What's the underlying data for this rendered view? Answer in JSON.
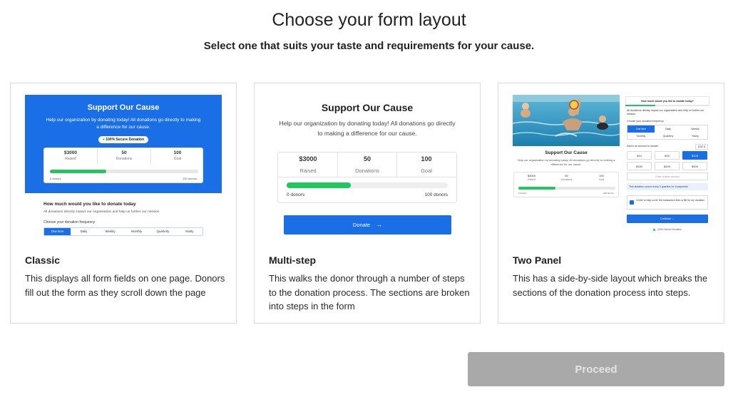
{
  "header": {
    "title": "Choose your form layout",
    "subtitle": "Select one that suits your taste and requirements for your cause."
  },
  "colors": {
    "accent": "#1a6ee6",
    "progress": "#22c55e",
    "button_disabled": "#a9a9a9"
  },
  "layouts": [
    {
      "title": "Classic",
      "description": "This displays all form fields on one page. Donors fill out the form as they scroll down the page",
      "preview": {
        "heading": "Support Our Cause",
        "text": "Help our organization by donating today! All donations go directly to making a difference for our cause.",
        "badge": "100% Secure Donation",
        "stats": [
          {
            "value": "$3000",
            "label": "Raised"
          },
          {
            "value": "50",
            "label": "Donations"
          },
          {
            "value": "100",
            "label": "Goal"
          }
        ],
        "progress_percent": 38,
        "progress_left": "0 donors",
        "progress_right": "100 donors",
        "question": "How much would you like to donate today",
        "question_sub": "All donations directly impact our organisation and help us further our mission",
        "frequency_label": "Choose your donation frequency",
        "frequency_options": [
          "One time",
          "Daily",
          "Weekly",
          "Monthly",
          "Quarterly",
          "Yearly"
        ]
      }
    },
    {
      "title": "Multi-step",
      "description": "This walks the donor through a number of steps to the donation process. The sections are broken into steps in the form",
      "preview": {
        "heading": "Support Our Cause",
        "text": "Help our organization by donating today! All donations go directly to making a difference for our cause.",
        "stats": [
          {
            "value": "$3000",
            "label": "Raised"
          },
          {
            "value": "50",
            "label": "Donations"
          },
          {
            "value": "100",
            "label": "Goal"
          }
        ],
        "progress_percent": 40,
        "progress_left": "0 donors",
        "progress_right": "100 donors",
        "button": "Donate",
        "button_arrow": "→"
      }
    },
    {
      "title": "Two Panel",
      "description": "This has a side-by-side layout which breaks the sections of the donation process into steps.",
      "preview": {
        "heading": "Support Our Cause",
        "text": "Help our organization by donating today! All donations go directly to making a difference for our cause.",
        "stats": [
          {
            "value": "$3000",
            "label": "Raised"
          },
          {
            "value": "50",
            "label": "Donations"
          },
          {
            "value": "100",
            "label": "Goal"
          }
        ],
        "progress_left": "0 donors",
        "progress_right": "100 donors",
        "question": "How much would you like to donate today?",
        "intro": "All donations directly impact our organization and help us further our mission.",
        "frequency_label": "Choose your donation frequency",
        "frequency_options": [
          "One time",
          "Daily",
          "Weekly",
          "Monthly",
          "Quarterly",
          "Yearly"
        ],
        "amount_label": "Select an amount to donate",
        "currency": "USD $",
        "amounts": [
          "$10",
          "$25",
          "$100",
          "$150",
          "$200",
          "$400"
        ],
        "other_placeholder": "Enter custom amount",
        "note": "This donation occurs every 3 quarters for 5 payments",
        "cover_fees": "I'd like to help cover the transaction fees of $6 for my donation",
        "button": "Continue →",
        "secure": "100% Secure Donation"
      }
    }
  ],
  "footer": {
    "proceed_label": "Proceed"
  }
}
